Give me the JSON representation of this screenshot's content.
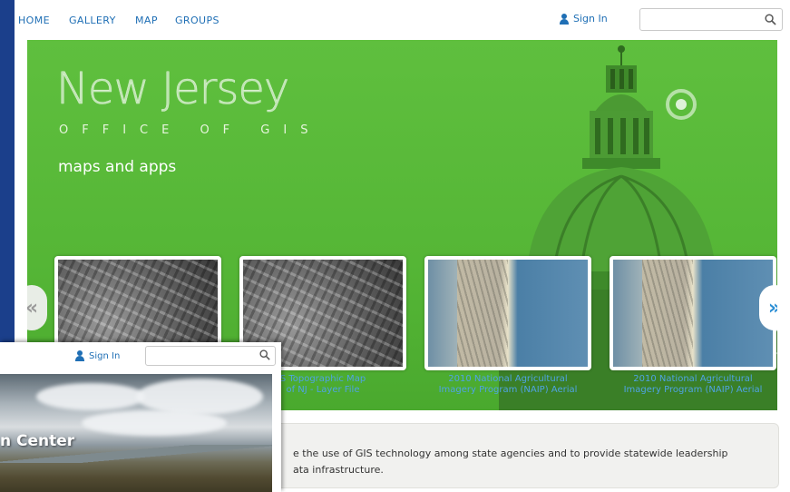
{
  "nav": {
    "items": [
      {
        "label": "HOME"
      },
      {
        "label": "GALLERY"
      },
      {
        "label": "MAP"
      },
      {
        "label": "GROUPS"
      }
    ],
    "sign_in": "Sign In",
    "search_placeholder": ""
  },
  "banner": {
    "title": "New Jersey",
    "subtitle": "OFFICE OF GIS",
    "tagline": "maps and apps"
  },
  "carousel": {
    "items": [
      {
        "caption_line1": "",
        "caption_line2": "",
        "style": "bw"
      },
      {
        "caption_line1": "S Topographic Map",
        "caption_line2": "of NJ - Layer File",
        "style": "bw"
      },
      {
        "caption_line1": "2010 National Agricultural",
        "caption_line2": "Imagery Program (NAIP) Aerial",
        "style": "aerial"
      },
      {
        "caption_line1": "2010 National Agricultural",
        "caption_line2": "Imagery Program (NAIP) Aerial",
        "style": "aerial"
      }
    ],
    "prev_symbol": "«",
    "next_symbol": "»"
  },
  "description": {
    "line1": "e the use of GIS technology among state agencies and to provide statewide leadership",
    "line2": "ata infrastructure."
  },
  "second_window": {
    "sign_in": "Sign In",
    "search_placeholder": "",
    "banner_title": "n Center"
  },
  "colors": {
    "desktop_bg": "#1b3f8b",
    "link_blue": "#1f6fb5",
    "banner_green": "#5fbf3e",
    "caption_blue": "#4fa3e3"
  }
}
